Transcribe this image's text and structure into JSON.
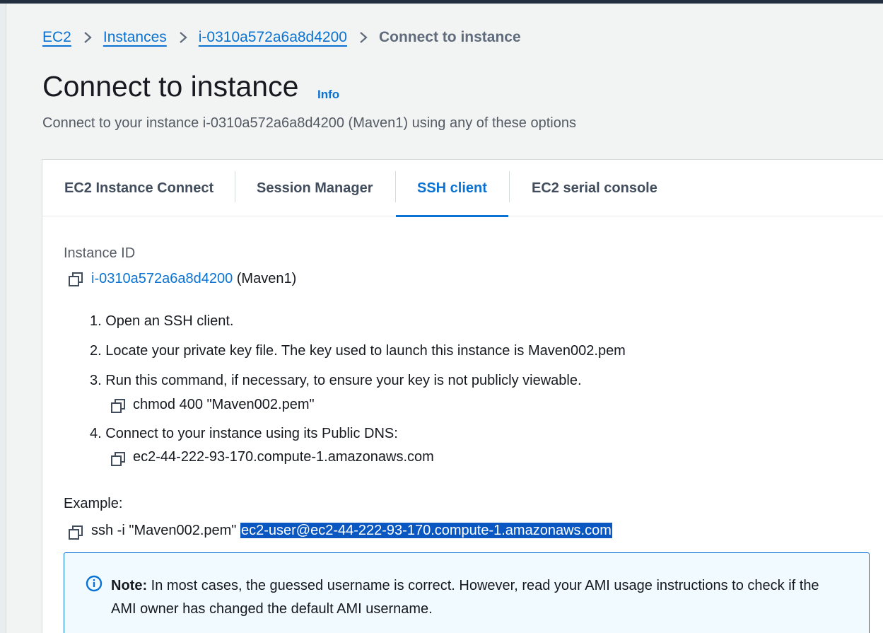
{
  "breadcrumb": {
    "items": [
      "EC2",
      "Instances",
      "i-0310a572a6a8d4200"
    ],
    "current": "Connect to instance"
  },
  "header": {
    "title": "Connect to instance",
    "info_link": "Info",
    "subtitle": "Connect to your instance i-0310a572a6a8d4200 (Maven1) using any of these options"
  },
  "tabs": [
    {
      "label": "EC2 Instance Connect"
    },
    {
      "label": "Session Manager"
    },
    {
      "label": "SSH client",
      "active": true
    },
    {
      "label": "EC2 serial console"
    }
  ],
  "instance": {
    "label": "Instance ID",
    "id": "i-0310a572a6a8d4200",
    "name": "(Maven1)"
  },
  "steps": [
    {
      "number": "1.",
      "text": "Open an SSH client."
    },
    {
      "number": "2.",
      "text": "Locate your private key file. The key used to launch this instance is Maven002.pem"
    },
    {
      "number": "3.",
      "text": "Run this command, if necessary, to ensure your key is not publicly viewable.",
      "command": "chmod 400 \"Maven002.pem\""
    },
    {
      "number": "4.",
      "text": "Connect to your instance using its Public DNS:",
      "command": "ec2-44-222-93-170.compute-1.amazonaws.com"
    }
  ],
  "example": {
    "label": "Example:",
    "command_prefix": "ssh -i \"Maven002.pem\"",
    "command_selected": "ec2-user@ec2-44-222-93-170.compute-1.amazonaws.com"
  },
  "note": {
    "bold": "Note:",
    "text": " In most cases, the guessed username is correct. However, read your AMI usage instructions to check if the AMI owner has changed the default AMI username."
  },
  "icons": {
    "copy": "copy-icon",
    "info": "info-circle-icon",
    "separator": "chevron-right-icon"
  },
  "colors": {
    "link": "#0972d3",
    "note_background": "#f1faff",
    "selection": "#0a57c2"
  }
}
